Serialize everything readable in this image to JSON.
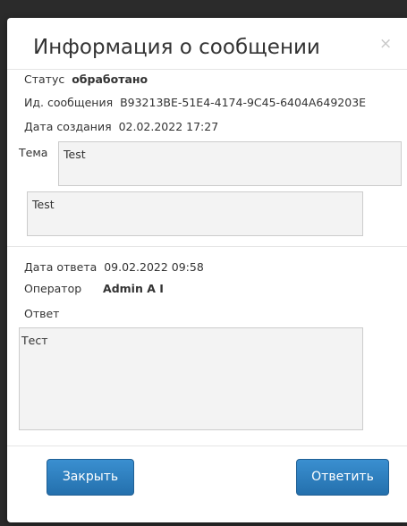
{
  "dialog": {
    "title": "Информация о сообщении",
    "close_symbol": "×"
  },
  "info": {
    "status_label": "Статус",
    "status_value": "обработано",
    "message_id_label": "Ид. сообщения",
    "message_id_value": "B93213BE-51E4-4174-9C45-6404A649203E",
    "created_label": "Дата создания",
    "created_value": "02.02.2022 17:27",
    "subject_label": "Тема",
    "subject_value": "Test",
    "body_value": "Test"
  },
  "reply": {
    "date_label": "Дата ответа",
    "date_value": "09.02.2022 09:58",
    "operator_label": "Оператор",
    "operator_value": "Admin A I",
    "answer_label": "Ответ",
    "answer_value": "Тест"
  },
  "buttons": {
    "close_label": "Закрыть",
    "reply_label": "Ответить"
  },
  "colors": {
    "button": "#2b7bbd",
    "backdrop": "#2b2b2b"
  }
}
